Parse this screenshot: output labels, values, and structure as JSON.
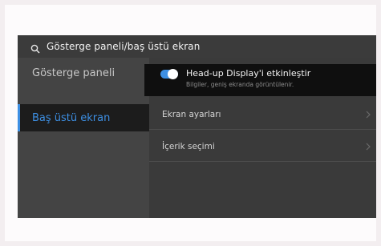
{
  "header": {
    "title": "Gösterge paneli/baş üstü ekran"
  },
  "sidebar": {
    "items": [
      {
        "label": "Gösterge paneli",
        "active": false
      },
      {
        "label": "Baş üstü ekran",
        "active": true
      }
    ]
  },
  "hud": {
    "title": "Head-up Display'i etkinleştir",
    "subtitle": "Bilgiler, geniş ekranda görüntülenir.",
    "enabled": true
  },
  "rows": [
    {
      "label": "Ekran ayarları"
    },
    {
      "label": "İçerik seçimi"
    }
  ],
  "icons": {
    "search": "search-icon",
    "back": "back-arrow-icon",
    "home": "home-icon",
    "menu": "menu-icon",
    "chevron": "chevron-right-icon"
  },
  "colors": {
    "accent": "#3d8fe3",
    "background": "#3a3a3a",
    "sidebar": "#444444",
    "highlight": "#0f0f0f"
  }
}
